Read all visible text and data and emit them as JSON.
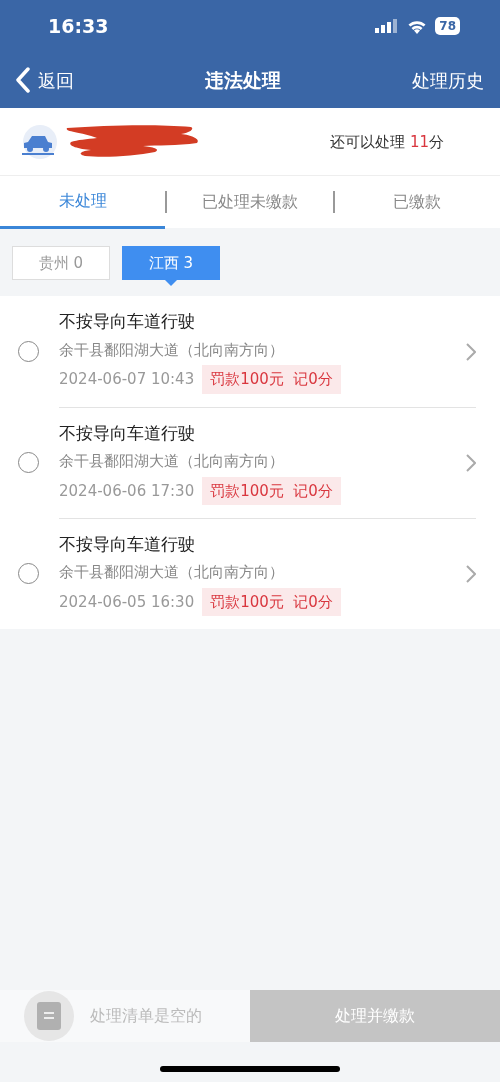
{
  "status_bar": {
    "time": "16:33",
    "battery": "78"
  },
  "nav": {
    "back": "返回",
    "title": "违法处理",
    "action": "处理历史"
  },
  "vehicle": {
    "remaining_label": "还可以处理",
    "remaining_points": "11",
    "remaining_unit": "分"
  },
  "tabs": [
    {
      "label": "未处理",
      "selected": true
    },
    {
      "label": "已处理未缴款",
      "selected": false
    },
    {
      "label": "已缴款",
      "selected": false
    }
  ],
  "regions": [
    {
      "label": "贵州 0",
      "selected": false
    },
    {
      "label": "江西 3",
      "selected": true
    }
  ],
  "violations": [
    {
      "title": "不按导向车道行驶",
      "location": "余干县鄱阳湖大道（北向南方向）",
      "time": "2024-06-07 10:43",
      "penalty": "罚款100元  记0分",
      "checked": false
    },
    {
      "title": "不按导向车道行驶",
      "location": "余干县鄱阳湖大道（北向南方向）",
      "time": "2024-06-06 17:30",
      "penalty": "罚款100元  记0分",
      "checked": false
    },
    {
      "title": "不按导向车道行驶",
      "location": "余干县鄱阳湖大道（北向南方向）",
      "time": "2024-06-05 16:30",
      "penalty": "罚款100元  记0分",
      "checked": false
    }
  ],
  "footer": {
    "cart_text": "处理清单是空的",
    "button": "处理并缴款",
    "disabled": true
  }
}
